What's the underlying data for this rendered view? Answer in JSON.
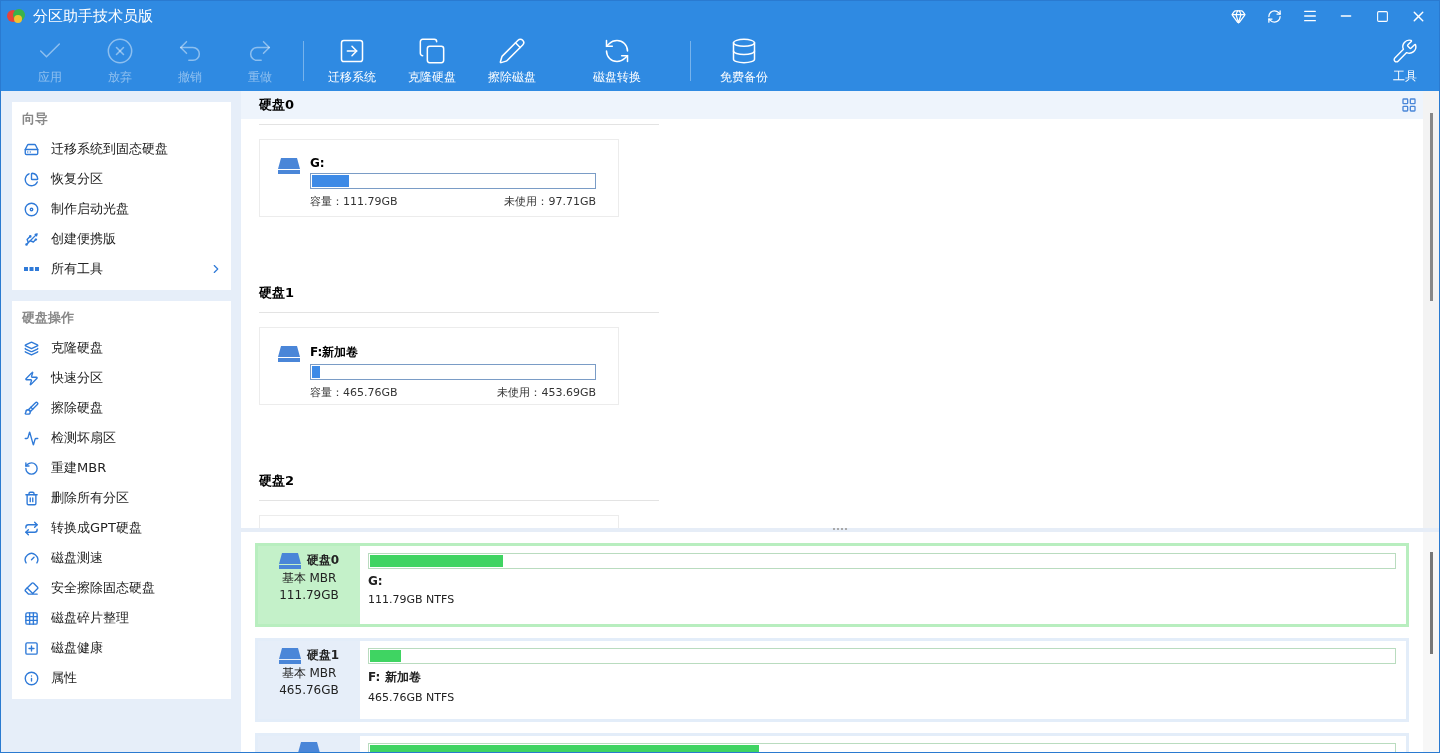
{
  "window": {
    "title": "分区助手技术员版"
  },
  "toolbar": [
    {
      "label": "应用",
      "disabled": true
    },
    {
      "label": "放弃",
      "disabled": true
    },
    {
      "label": "撤销",
      "disabled": true
    },
    {
      "label": "重做",
      "disabled": true
    },
    {
      "label": "迁移系统",
      "disabled": false
    },
    {
      "label": "克隆硬盘",
      "disabled": false
    },
    {
      "label": "擦除磁盘",
      "disabled": false
    },
    {
      "label": "磁盘转换",
      "disabled": false
    },
    {
      "label": "免费备份",
      "disabled": false
    }
  ],
  "tools_button": {
    "label": "工具"
  },
  "sidebar": {
    "sections": [
      {
        "title": "向导",
        "items": [
          {
            "label": "迁移系统到固态硬盘",
            "has_submenu": false
          },
          {
            "label": "恢复分区",
            "has_submenu": false
          },
          {
            "label": "制作启动光盘",
            "has_submenu": false
          },
          {
            "label": "创建便携版",
            "has_submenu": false
          },
          {
            "label": "所有工具",
            "has_submenu": true
          }
        ]
      },
      {
        "title": "硬盘操作",
        "items": [
          {
            "label": "克隆硬盘",
            "has_submenu": false
          },
          {
            "label": "快速分区",
            "has_submenu": false
          },
          {
            "label": "擦除硬盘",
            "has_submenu": false
          },
          {
            "label": "检测坏扇区",
            "has_submenu": false
          },
          {
            "label": "重建MBR",
            "has_submenu": false
          },
          {
            "label": "删除所有分区",
            "has_submenu": false
          },
          {
            "label": "转换成GPT硬盘",
            "has_submenu": false
          },
          {
            "label": "磁盘测速",
            "has_submenu": false
          },
          {
            "label": "安全擦除固态硬盘",
            "has_submenu": false
          },
          {
            "label": "磁盘碎片整理",
            "has_submenu": false
          },
          {
            "label": "磁盘健康",
            "has_submenu": false
          },
          {
            "label": "属性",
            "has_submenu": false
          }
        ]
      }
    ]
  },
  "disk_cards": [
    {
      "title": "硬盘0",
      "selected": true,
      "partitions": [
        {
          "name": "G:",
          "level": 0.13,
          "capacity": "容量：111.79GB",
          "free": "未使用：97.71GB"
        }
      ]
    },
    {
      "title": "硬盘1",
      "selected": false,
      "partitions": [
        {
          "name": "F:新加卷",
          "level": 0.03,
          "capacity": "容量：465.76GB",
          "free": "未使用：453.69GB"
        }
      ]
    },
    {
      "title": "硬盘2",
      "selected": false
    }
  ],
  "disk_list": [
    {
      "name": "硬盘0",
      "type": "基本 MBR",
      "size": "111.79GB",
      "selected": true,
      "partitions": [
        {
          "label": "G:",
          "info": "111.79GB NTFS",
          "level": 0.13
        }
      ]
    },
    {
      "name": "硬盘1",
      "type": "基本 MBR",
      "size": "465.76GB",
      "selected": false,
      "partitions": [
        {
          "label": "F: 新加卷",
          "info": "465.76GB NTFS",
          "level": 0.03
        }
      ]
    },
    {
      "selected": false,
      "partitions": [
        {
          "level": 0.38
        }
      ]
    }
  ]
}
